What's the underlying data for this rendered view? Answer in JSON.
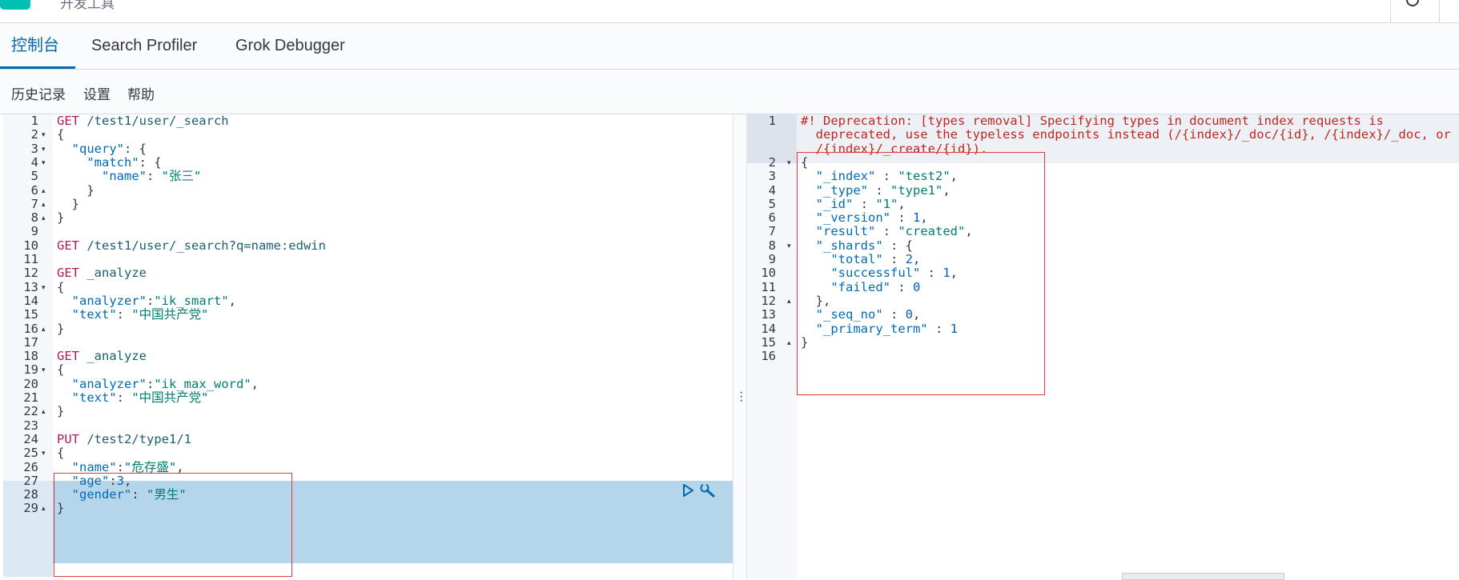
{
  "header": {
    "title": "开发工具"
  },
  "tabs": [
    {
      "label": "控制台",
      "active": true
    },
    {
      "label": "Search Profiler",
      "active": false
    },
    {
      "label": "Grok Debugger",
      "active": false
    }
  ],
  "menu": [
    {
      "label": "历史记录"
    },
    {
      "label": "设置"
    },
    {
      "label": "帮助"
    }
  ],
  "request_editor": {
    "lines": [
      {
        "n": "1",
        "fold": "",
        "parts": [
          [
            "method",
            "GET"
          ],
          [
            "path",
            " /test1/user/_search"
          ]
        ]
      },
      {
        "n": "2",
        "fold": "▾",
        "parts": [
          [
            "punct",
            "{"
          ]
        ]
      },
      {
        "n": "3",
        "fold": "▾",
        "parts": [
          [
            "punct",
            "  "
          ],
          [
            "key",
            "\"query\""
          ],
          [
            "punct",
            ": {"
          ]
        ]
      },
      {
        "n": "4",
        "fold": "▾",
        "parts": [
          [
            "punct",
            "    "
          ],
          [
            "key",
            "\"match\""
          ],
          [
            "punct",
            ": {"
          ]
        ]
      },
      {
        "n": "5",
        "fold": "",
        "parts": [
          [
            "punct",
            "      "
          ],
          [
            "key",
            "\"name\""
          ],
          [
            "punct",
            ": "
          ],
          [
            "str",
            "\"张三\""
          ]
        ]
      },
      {
        "n": "6",
        "fold": "▴",
        "parts": [
          [
            "punct",
            "    }"
          ]
        ]
      },
      {
        "n": "7",
        "fold": "▴",
        "parts": [
          [
            "punct",
            "  }"
          ]
        ]
      },
      {
        "n": "8",
        "fold": "▴",
        "parts": [
          [
            "punct",
            "}"
          ]
        ]
      },
      {
        "n": "9",
        "fold": "",
        "parts": []
      },
      {
        "n": "10",
        "fold": "",
        "parts": [
          [
            "method",
            "GET"
          ],
          [
            "path",
            " /test1/user/_search?q=name:edwin"
          ]
        ]
      },
      {
        "n": "11",
        "fold": "",
        "parts": []
      },
      {
        "n": "12",
        "fold": "",
        "parts": [
          [
            "method",
            "GET"
          ],
          [
            "path",
            " _analyze"
          ]
        ]
      },
      {
        "n": "13",
        "fold": "▾",
        "parts": [
          [
            "punct",
            "{"
          ]
        ]
      },
      {
        "n": "14",
        "fold": "",
        "parts": [
          [
            "punct",
            "  "
          ],
          [
            "key",
            "\"analyzer\""
          ],
          [
            "punct",
            ":"
          ],
          [
            "str",
            "\"ik_smart\""
          ],
          [
            "punct",
            ","
          ]
        ]
      },
      {
        "n": "15",
        "fold": "",
        "parts": [
          [
            "punct",
            "  "
          ],
          [
            "key",
            "\"text\""
          ],
          [
            "punct",
            ": "
          ],
          [
            "str",
            "\"中国共产党\""
          ]
        ]
      },
      {
        "n": "16",
        "fold": "▴",
        "parts": [
          [
            "punct",
            "}"
          ]
        ]
      },
      {
        "n": "17",
        "fold": "",
        "parts": []
      },
      {
        "n": "18",
        "fold": "",
        "parts": [
          [
            "method",
            "GET"
          ],
          [
            "path",
            " _analyze"
          ]
        ]
      },
      {
        "n": "19",
        "fold": "▾",
        "parts": [
          [
            "punct",
            "{"
          ]
        ]
      },
      {
        "n": "20",
        "fold": "",
        "parts": [
          [
            "punct",
            "  "
          ],
          [
            "key",
            "\"analyzer\""
          ],
          [
            "punct",
            ":"
          ],
          [
            "str",
            "\"ik_max_word\""
          ],
          [
            "punct",
            ","
          ]
        ]
      },
      {
        "n": "21",
        "fold": "",
        "parts": [
          [
            "punct",
            "  "
          ],
          [
            "key",
            "\"text\""
          ],
          [
            "punct",
            ": "
          ],
          [
            "str",
            "\"中国共产党\""
          ]
        ]
      },
      {
        "n": "22",
        "fold": "▴",
        "parts": [
          [
            "punct",
            "}"
          ]
        ]
      },
      {
        "n": "23",
        "fold": "",
        "parts": []
      },
      {
        "n": "24",
        "fold": "",
        "parts": [
          [
            "method",
            "PUT"
          ],
          [
            "path",
            " /test2/type1/1"
          ]
        ]
      },
      {
        "n": "25",
        "fold": "▾",
        "parts": [
          [
            "punct",
            "{"
          ]
        ]
      },
      {
        "n": "26",
        "fold": "",
        "parts": [
          [
            "punct",
            "  "
          ],
          [
            "key",
            "\"name\""
          ],
          [
            "punct",
            ":"
          ],
          [
            "str",
            "\"危存盛\""
          ],
          [
            "punct",
            ","
          ]
        ]
      },
      {
        "n": "27",
        "fold": "",
        "parts": [
          [
            "punct",
            "  "
          ],
          [
            "key",
            "\"age\""
          ],
          [
            "punct",
            ":"
          ],
          [
            "num",
            "3"
          ],
          [
            "punct",
            ","
          ]
        ]
      },
      {
        "n": "28",
        "fold": "",
        "parts": [
          [
            "punct",
            "  "
          ],
          [
            "key",
            "\"gender\""
          ],
          [
            "punct",
            ": "
          ],
          [
            "str",
            "\"男生\""
          ]
        ]
      },
      {
        "n": "29",
        "fold": "▴",
        "parts": [
          [
            "punct",
            "}"
          ]
        ]
      }
    ],
    "actions": {
      "run": "play-icon",
      "wrench": "wrench-icon"
    }
  },
  "response_editor": {
    "lines": [
      {
        "n": "1",
        "fold": "",
        "parts": [
          [
            "warn",
            "#! Deprecation: [types removal] Specifying types in document index requests is"
          ]
        ]
      },
      {
        "n": "",
        "fold": "",
        "parts": [
          [
            "warn",
            "  deprecated, use the typeless endpoints instead (/{index}/_doc/{id}, /{index}/_doc, or"
          ]
        ]
      },
      {
        "n": "",
        "fold": "",
        "parts": [
          [
            "warn",
            "  /{index}/_create/{id})."
          ]
        ]
      },
      {
        "n": "2",
        "fold": "▾",
        "parts": [
          [
            "punct",
            "{"
          ]
        ]
      },
      {
        "n": "3",
        "fold": "",
        "parts": [
          [
            "punct",
            "  "
          ],
          [
            "key",
            "\"_index\""
          ],
          [
            "punct",
            " : "
          ],
          [
            "str",
            "\"test2\""
          ],
          [
            "punct",
            ","
          ]
        ]
      },
      {
        "n": "4",
        "fold": "",
        "parts": [
          [
            "punct",
            "  "
          ],
          [
            "key",
            "\"_type\""
          ],
          [
            "punct",
            " : "
          ],
          [
            "str",
            "\"type1\""
          ],
          [
            "punct",
            ","
          ]
        ]
      },
      {
        "n": "5",
        "fold": "",
        "parts": [
          [
            "punct",
            "  "
          ],
          [
            "key",
            "\"_id\""
          ],
          [
            "punct",
            " : "
          ],
          [
            "str",
            "\"1\""
          ],
          [
            "punct",
            ","
          ]
        ]
      },
      {
        "n": "6",
        "fold": "",
        "parts": [
          [
            "punct",
            "  "
          ],
          [
            "key",
            "\"_version\""
          ],
          [
            "punct",
            " : "
          ],
          [
            "num",
            "1"
          ],
          [
            "punct",
            ","
          ]
        ]
      },
      {
        "n": "7",
        "fold": "",
        "parts": [
          [
            "punct",
            "  "
          ],
          [
            "key",
            "\"result\""
          ],
          [
            "punct",
            " : "
          ],
          [
            "str",
            "\"created\""
          ],
          [
            "punct",
            ","
          ]
        ]
      },
      {
        "n": "8",
        "fold": "▾",
        "parts": [
          [
            "punct",
            "  "
          ],
          [
            "key",
            "\"_shards\""
          ],
          [
            "punct",
            " : {"
          ]
        ]
      },
      {
        "n": "9",
        "fold": "",
        "parts": [
          [
            "punct",
            "    "
          ],
          [
            "key",
            "\"total\""
          ],
          [
            "punct",
            " : "
          ],
          [
            "num",
            "2"
          ],
          [
            "punct",
            ","
          ]
        ]
      },
      {
        "n": "10",
        "fold": "",
        "parts": [
          [
            "punct",
            "    "
          ],
          [
            "key",
            "\"successful\""
          ],
          [
            "punct",
            " : "
          ],
          [
            "num",
            "1"
          ],
          [
            "punct",
            ","
          ]
        ]
      },
      {
        "n": "11",
        "fold": "",
        "parts": [
          [
            "punct",
            "    "
          ],
          [
            "key",
            "\"failed\""
          ],
          [
            "punct",
            " : "
          ],
          [
            "num",
            "0"
          ]
        ]
      },
      {
        "n": "12",
        "fold": "▴",
        "parts": [
          [
            "punct",
            "  },"
          ]
        ]
      },
      {
        "n": "13",
        "fold": "",
        "parts": [
          [
            "punct",
            "  "
          ],
          [
            "key",
            "\"_seq_no\""
          ],
          [
            "punct",
            " : "
          ],
          [
            "num",
            "0"
          ],
          [
            "punct",
            ","
          ]
        ]
      },
      {
        "n": "14",
        "fold": "",
        "parts": [
          [
            "punct",
            "  "
          ],
          [
            "key",
            "\"_primary_term\""
          ],
          [
            "punct",
            " : "
          ],
          [
            "num",
            "1"
          ]
        ]
      },
      {
        "n": "15",
        "fold": "▴",
        "parts": [
          [
            "punct",
            "}"
          ]
        ]
      },
      {
        "n": "16",
        "fold": "",
        "parts": []
      }
    ]
  }
}
